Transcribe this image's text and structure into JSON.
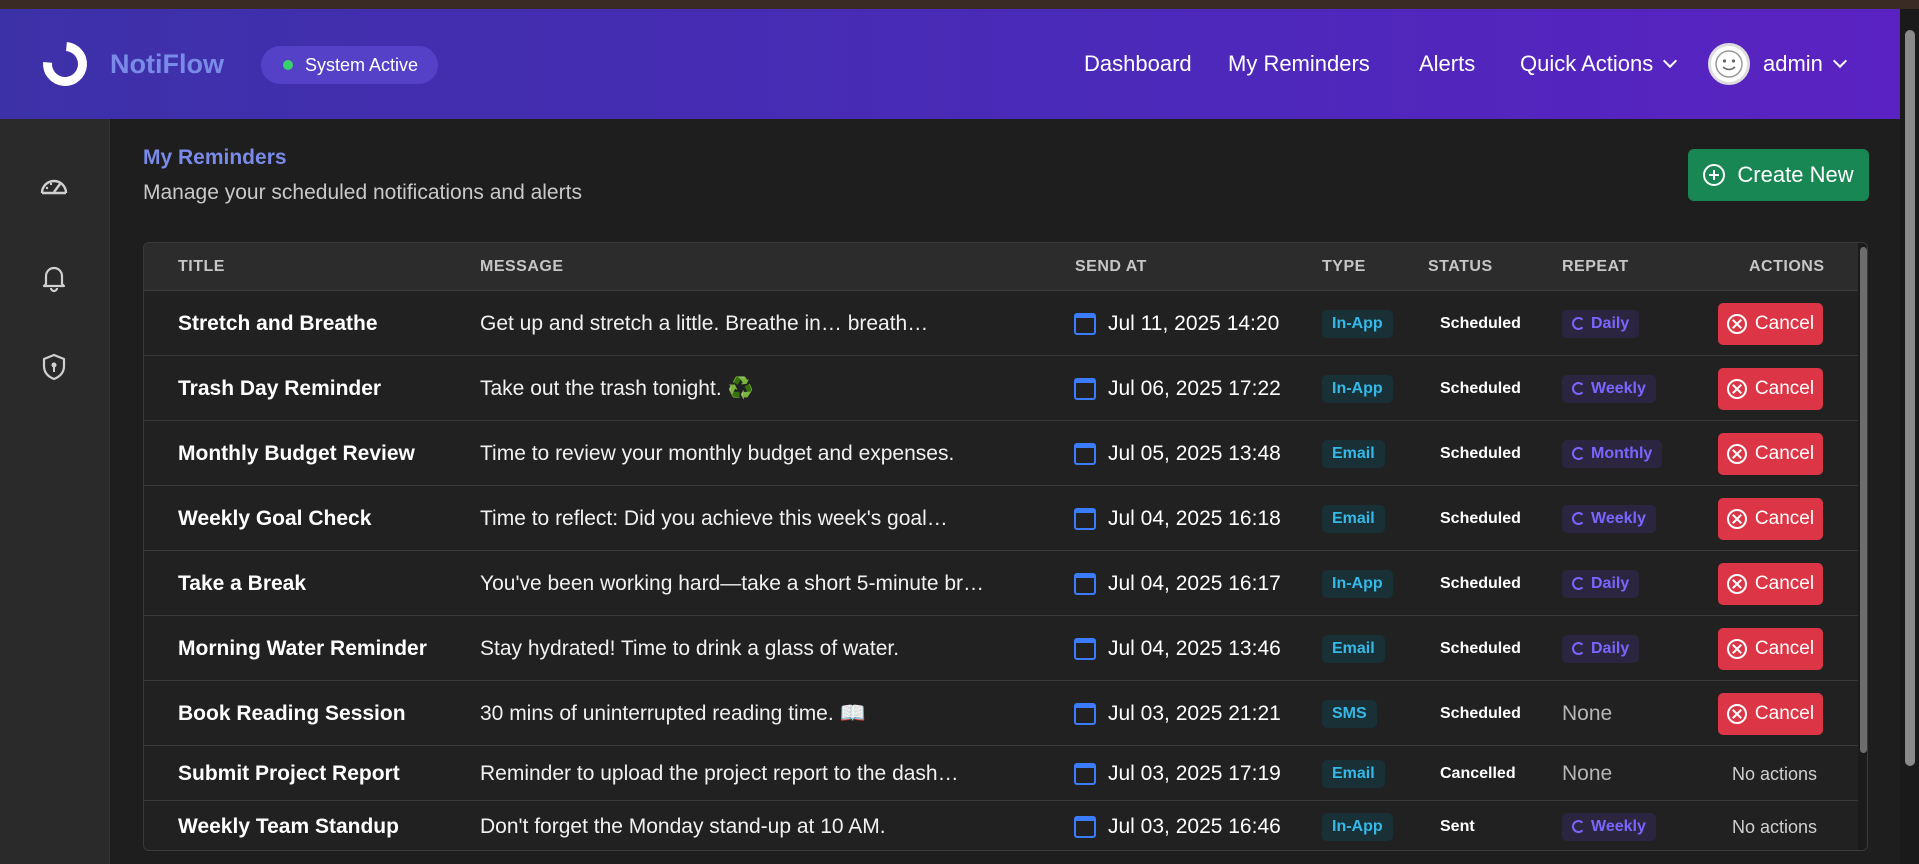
{
  "app": {
    "brand": "NotiFlow",
    "status": "System Active",
    "nav": [
      "Dashboard",
      "My Reminders",
      "Alerts",
      "Quick Actions"
    ],
    "user": "admin"
  },
  "sidebar": {
    "icons": [
      "speedometer-icon",
      "bell-icon",
      "shield-icon"
    ]
  },
  "page": {
    "title": "My Reminders",
    "subtitle": "Manage your scheduled notifications and alerts",
    "create_label": "Create New"
  },
  "table": {
    "headers": [
      "TITLE",
      "MESSAGE",
      "SEND AT",
      "TYPE",
      "STATUS",
      "REPEAT",
      "ACTIONS"
    ],
    "rows": [
      {
        "title": "Stretch and Breathe",
        "message": "Get up and stretch a little. Breathe in… breath…",
        "send_at": "Jul 11, 2025 14:20",
        "type": "In-App",
        "status": "Scheduled",
        "repeat": "Daily",
        "action": "Cancel"
      },
      {
        "title": "Trash Day Reminder",
        "message": "Take out the trash tonight. ♻️",
        "send_at": "Jul 06, 2025 17:22",
        "type": "In-App",
        "status": "Scheduled",
        "repeat": "Weekly",
        "action": "Cancel"
      },
      {
        "title": "Monthly Budget Review",
        "message": "Time to review your monthly budget and expenses.",
        "send_at": "Jul 05, 2025 13:48",
        "type": "Email",
        "status": "Scheduled",
        "repeat": "Monthly",
        "action": "Cancel"
      },
      {
        "title": "Weekly Goal Check",
        "message": "Time to reflect: Did you achieve this week's goal…",
        "send_at": "Jul 04, 2025 16:18",
        "type": "Email",
        "status": "Scheduled",
        "repeat": "Weekly",
        "action": "Cancel"
      },
      {
        "title": "Take a Break",
        "message": "You've been working hard—take a short 5-minute br…",
        "send_at": "Jul 04, 2025 16:17",
        "type": "In-App",
        "status": "Scheduled",
        "repeat": "Daily",
        "action": "Cancel"
      },
      {
        "title": "Morning Water Reminder",
        "message": "Stay hydrated! Time to drink a glass of water.",
        "send_at": "Jul 04, 2025 13:46",
        "type": "Email",
        "status": "Scheduled",
        "repeat": "Daily",
        "action": "Cancel"
      },
      {
        "title": "Book Reading Session",
        "message": "30 mins of uninterrupted reading time. 📖",
        "send_at": "Jul 03, 2025 21:21",
        "type": "SMS",
        "status": "Scheduled",
        "repeat": "None",
        "action": "Cancel"
      },
      {
        "title": "Submit Project Report",
        "message": "Reminder to upload the project report to the dash…",
        "send_at": "Jul 03, 2025 17:19",
        "type": "Email",
        "status": "Cancelled",
        "repeat": "None",
        "action": "No actions"
      },
      {
        "title": "Weekly Team Standup",
        "message": "Don't forget the Monday stand-up at 10 AM.",
        "send_at": "Jul 03, 2025 16:46",
        "type": "In-App",
        "status": "Sent",
        "repeat": "Weekly",
        "action": "No actions"
      }
    ]
  }
}
